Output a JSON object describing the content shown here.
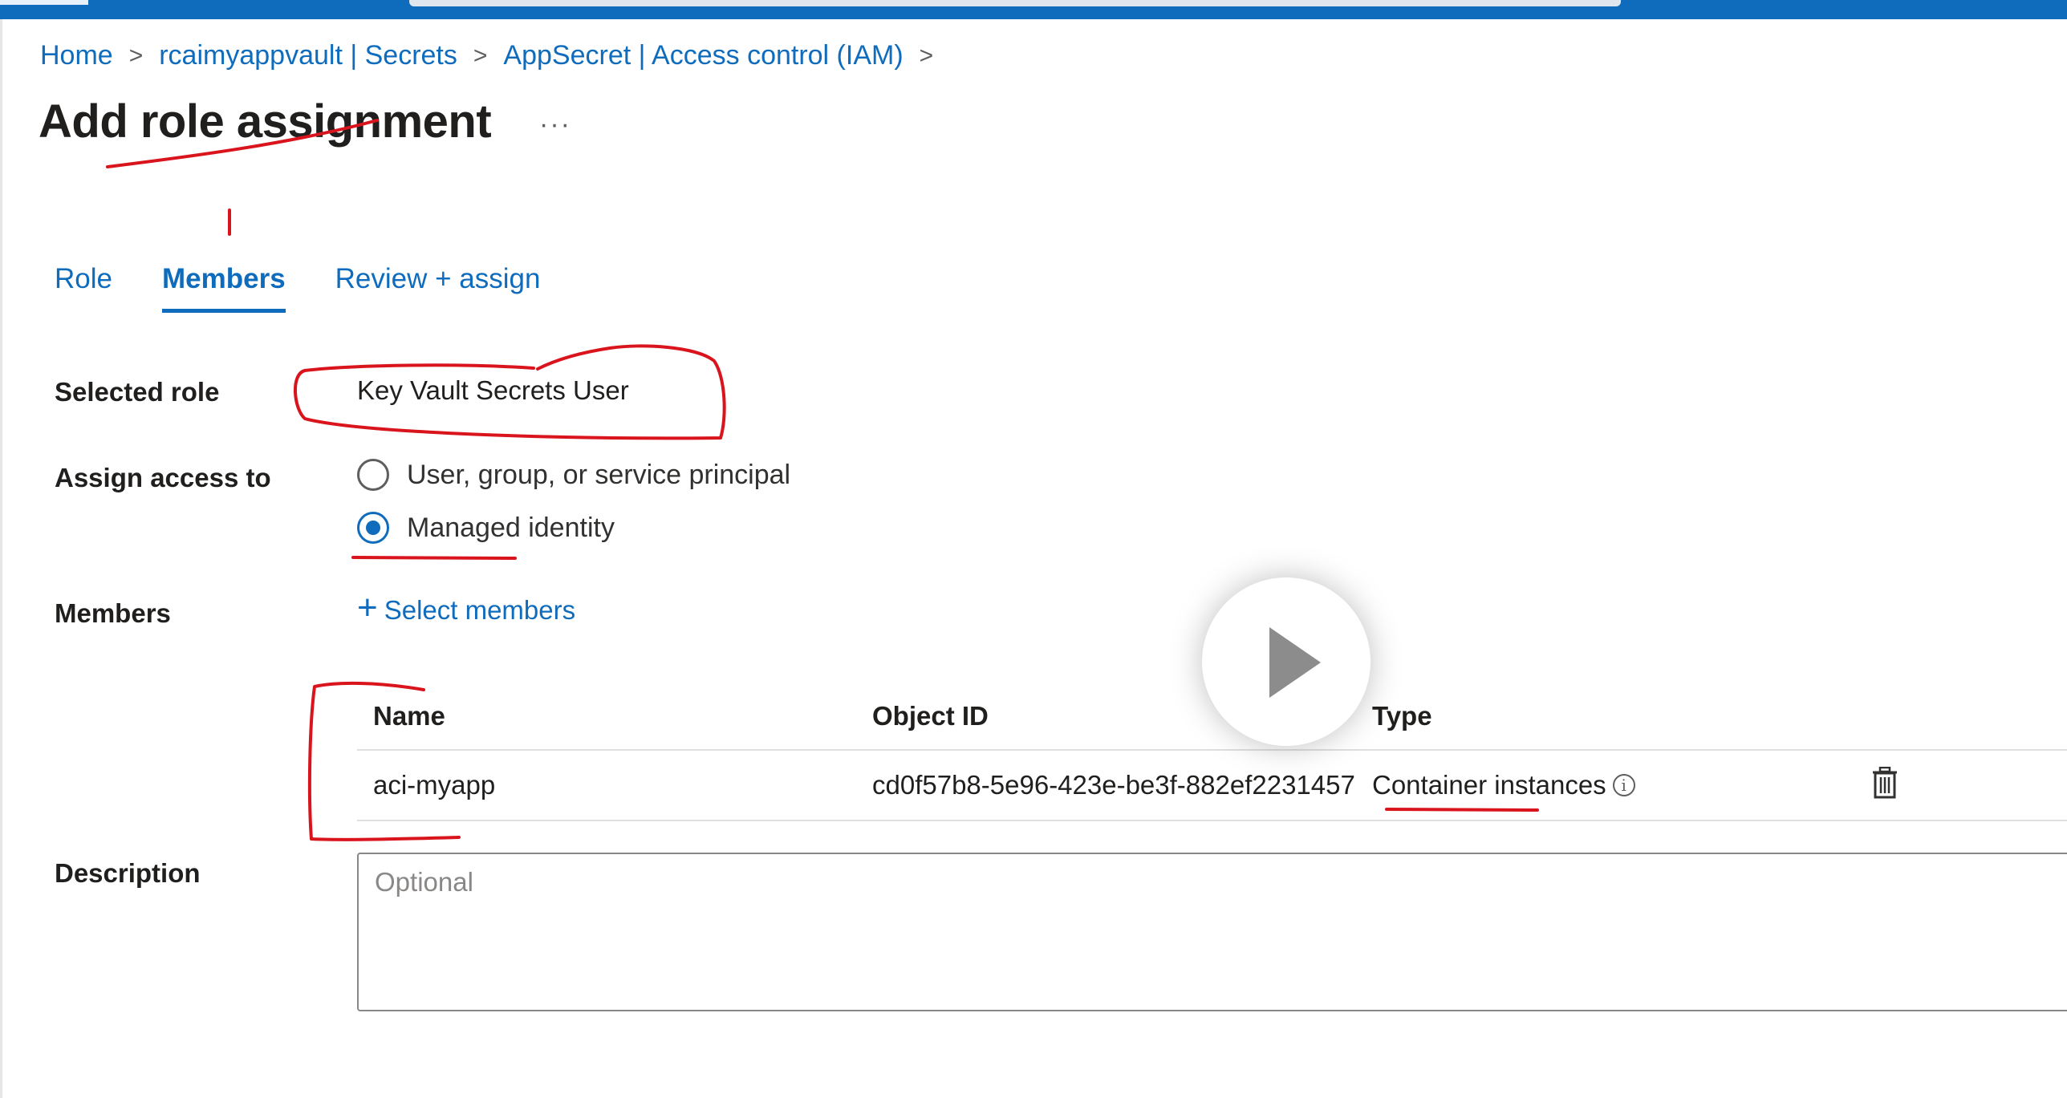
{
  "breadcrumb": {
    "items": [
      "Home",
      "rcaimyappvault | Secrets",
      "AppSecret | Access control (IAM)"
    ],
    "separator": ">"
  },
  "page": {
    "title": "Add role assignment",
    "more_label": "···"
  },
  "tabs": [
    {
      "label": "Role",
      "active": false
    },
    {
      "label": "Members",
      "active": true
    },
    {
      "label": "Review + assign",
      "active": false
    }
  ],
  "form": {
    "selected_role_label": "Selected role",
    "selected_role_value": "Key Vault Secrets User",
    "assign_access_label": "Assign access to",
    "assign_options": [
      {
        "label": "User, group, or service principal",
        "checked": false
      },
      {
        "label": "Managed identity",
        "checked": true
      }
    ],
    "members_label": "Members",
    "select_members_label": "Select members",
    "description_label": "Description",
    "description_placeholder": "Optional",
    "description_value": ""
  },
  "members_table": {
    "columns": [
      "Name",
      "Object ID",
      "Type"
    ],
    "rows": [
      {
        "name": "aci-myapp",
        "object_id": "cd0f57b8-5e96-423e-be3f-882ef2231457",
        "type": "Container instances"
      }
    ]
  },
  "icons": {
    "info": "info-icon",
    "delete": "trash-icon",
    "add": "plus-icon",
    "play": "play-icon"
  },
  "colors": {
    "accent": "#0f6cbd",
    "annotation": "#d9141c",
    "topbar": "#0f6cbd"
  }
}
